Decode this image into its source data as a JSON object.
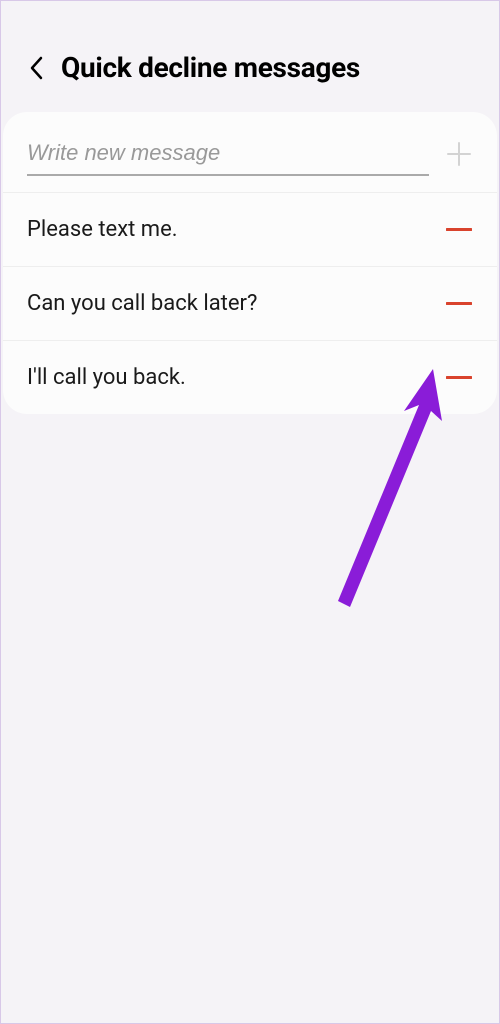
{
  "header": {
    "title": "Quick decline messages"
  },
  "input": {
    "placeholder": "Write new message"
  },
  "messages": [
    {
      "text": "Please text me."
    },
    {
      "text": "Can you call back later?"
    },
    {
      "text": "I'll call you back."
    }
  ],
  "colors": {
    "accent_red": "#d9432d",
    "arrow": "#8a1cd8"
  }
}
